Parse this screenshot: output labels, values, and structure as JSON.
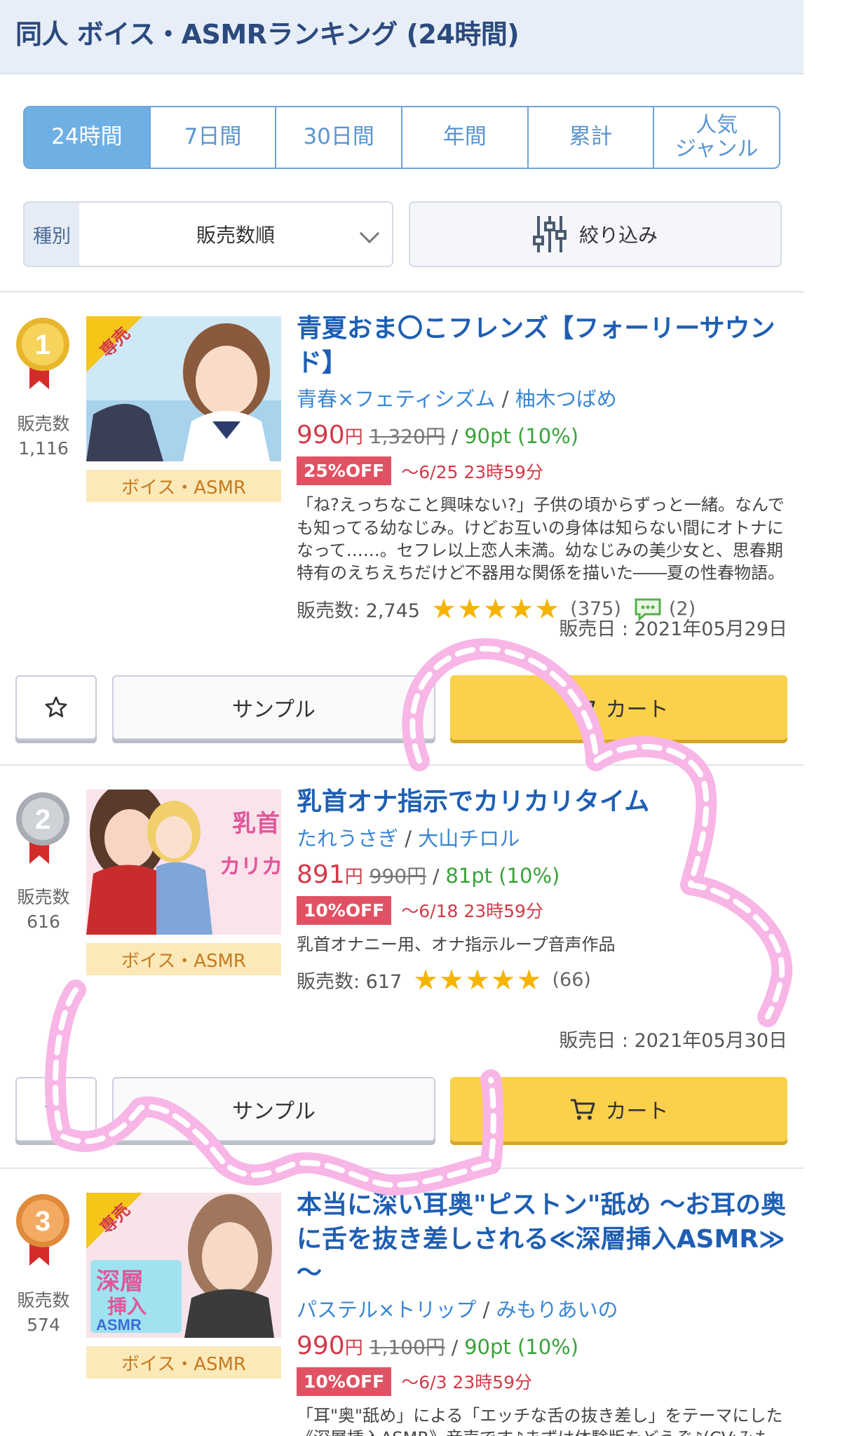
{
  "header": {
    "title": "同人 ボイス・ASMRランキング (24時間)"
  },
  "tabs": [
    {
      "label": "24時間",
      "active": true
    },
    {
      "label": "7日間",
      "active": false
    },
    {
      "label": "30日間",
      "active": false
    },
    {
      "label": "年間",
      "active": false
    },
    {
      "label": "累計",
      "active": false
    },
    {
      "label": "人気\nジャンル",
      "active": false
    }
  ],
  "sort": {
    "label": "種別",
    "value": "販売数順"
  },
  "filter": {
    "label": "絞り込み"
  },
  "colors": {
    "accent": "#6fb0e4",
    "title_blue": "#1f5fb3",
    "price_red": "#d23a48",
    "cart_yellow": "#fbd14c",
    "doodle_pink": "#f7b6e6"
  },
  "items": [
    {
      "rank": "1",
      "medal_color": "gold",
      "sales_label": "販売数",
      "sales_count": "1,116",
      "exclusive_badge": "専売",
      "genre": "ボイス・ASMR",
      "title": "青夏おま〇こフレンズ【フォーリーサウンド】",
      "circle": "青春×フェティシズム",
      "author": "柚木つばめ",
      "price": "990",
      "yen": "円",
      "old_price": "1,320円",
      "points": "90pt (10%)",
      "off": "25%OFF",
      "deadline": "～6/25 23時59分",
      "description": "「ね?えっちなこと興味ない?」子供の頃からずっと一緒。なんでも知ってる幼なじみ。けどお互いの身体は知らない間にオトナになって……。セフレ以上恋人未満。幼なじみの美少女と、思春期特有のえちえちだけど不器用な関係を描いた――夏の性春物語。",
      "sales_text": "販売数: 2,745",
      "stars": "★★★★★",
      "reviews": "(375)",
      "comments": "(2)",
      "release": "販売日 : 2021年05月29日",
      "sample_label": "サンプル",
      "cart_label": "カート"
    },
    {
      "rank": "2",
      "medal_color": "silver",
      "sales_label": "販売数",
      "sales_count": "616",
      "genre": "ボイス・ASMR",
      "title": "乳首オナ指示でカリカリタイム",
      "circle": "たれうさぎ",
      "author": "大山チロル",
      "price": "891",
      "yen": "円",
      "old_price": "990円",
      "points": "81pt (10%)",
      "off": "10%OFF",
      "deadline": "～6/18 23時59分",
      "description": "乳首オナニー用、オナ指示ループ音声作品",
      "sales_text": "販売数: 617",
      "stars": "★★★★★",
      "reviews": "(66)",
      "release": "販売日 : 2021年05月30日",
      "sample_label": "サンプル",
      "cart_label": "カート"
    },
    {
      "rank": "3",
      "medal_color": "bronze",
      "sales_label": "販売数",
      "sales_count": "574",
      "exclusive_badge": "専売",
      "genre": "ボイス・ASMR",
      "title": "本当に深い耳奥\"ピストン\"舐め ～お耳の奥に舌を抜き差しされる≪深層挿入ASMR≫～",
      "circle": "パステル×トリップ",
      "author": "みもりあいの",
      "price": "990",
      "yen": "円",
      "old_price": "1,100円",
      "points": "90pt (10%)",
      "off": "10%OFF",
      "deadline": "～6/3 23時59分",
      "description": "「耳\"奥\"舐め」による「エッチな舌の抜き差し」をテーマにした《深層挿入ASMR》音声です♪まずは体験版をどうぞ♪(CV:みもりあいの様)"
    }
  ]
}
